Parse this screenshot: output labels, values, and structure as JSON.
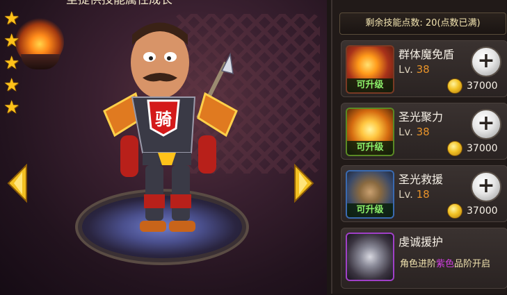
{
  "header": {
    "title": "至提供技能属性成长"
  },
  "hero": {
    "stars": 5,
    "chest_emblem": "骑"
  },
  "skill_panel": {
    "points_text": "剩余技能点数: 20(点数已满)",
    "upgradable_label": "可升级",
    "level_prefix": "Lv.",
    "skills": [
      {
        "name": "群体魔免盾",
        "level": "38",
        "cost": "37000",
        "icon": "fire-slash-icon"
      },
      {
        "name": "圣光聚力",
        "level": "38",
        "cost": "37000",
        "icon": "holy-burst-icon"
      },
      {
        "name": "圣光救援",
        "level": "18",
        "cost": "37000",
        "icon": "holy-rescue-icon"
      }
    ],
    "locked_skill": {
      "name": "虔诚援护",
      "unlock_pre": "角色进阶",
      "unlock_color": "紫色",
      "unlock_post": "品阶开启",
      "icon": "sword-icon"
    }
  },
  "colors": {
    "accent_gold": "#ffc21a",
    "level_orange": "#e8932a",
    "upgrade_green": "#8cf06a",
    "purple": "#d040e0"
  }
}
